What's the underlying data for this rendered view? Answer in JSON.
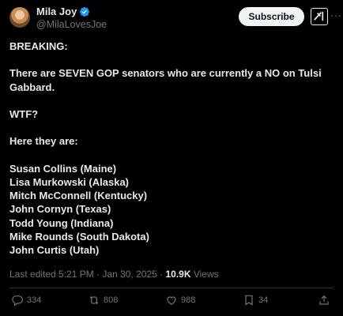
{
  "author": {
    "display_name": "Mila Joy",
    "handle": "@MilaLovesJoe"
  },
  "header": {
    "subscribe_label": "Subscribe",
    "grok_icon": "grok-icon",
    "more_icon": "more-icon"
  },
  "post": {
    "lines": [
      "BREAKING:",
      "",
      "There are SEVEN GOP senators who are currently a NO on Tulsi",
      "Gabbard.",
      "",
      "WTF?",
      "",
      "Here they are:",
      "",
      "Susan Collins (Maine)",
      "Lisa Murkowski (Alaska)",
      "Mitch McConnell (Kentucky)",
      "John Cornyn (Texas)",
      "Todd Young (Indiana)",
      "Mike Rounds (South Dakota)",
      "John Curtis (Utah)"
    ]
  },
  "meta": {
    "edited": "Last edited 5:21 PM · Jan 30, 2025 · ",
    "views_count": "10.9K",
    "views_label": " Views"
  },
  "actions": {
    "replies": "334",
    "reposts": "808",
    "likes": "988",
    "bookmarks": "34"
  },
  "colors": {
    "background": "#000000",
    "text": "#e7e9ea",
    "muted": "#71767b",
    "verified": "#1d9bf0"
  }
}
